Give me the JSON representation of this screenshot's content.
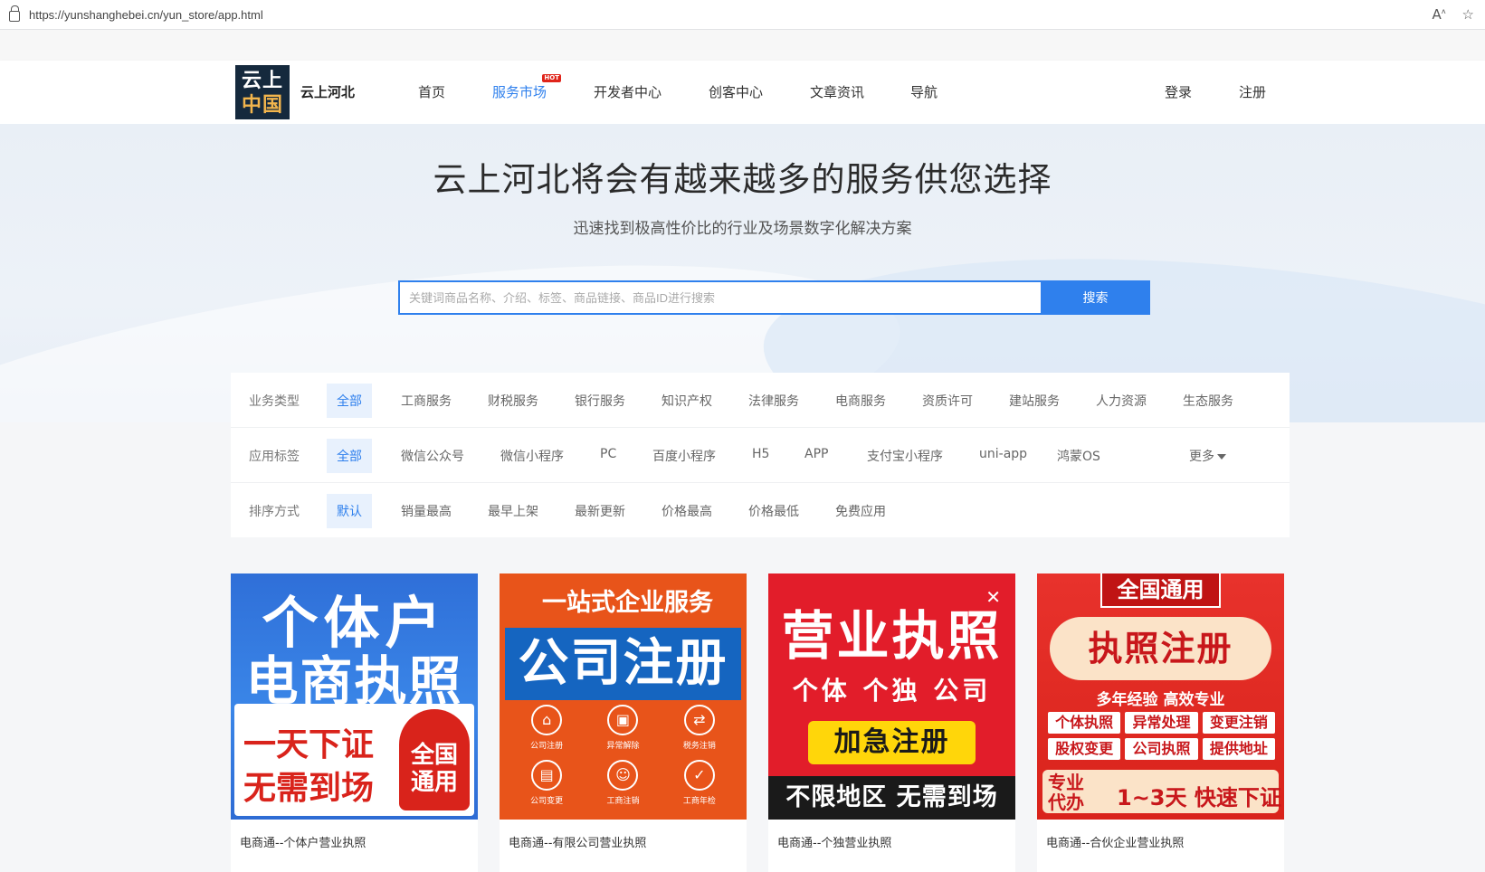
{
  "browser": {
    "url": "https://yunshanghebei.cn/yun_store/app.html"
  },
  "header": {
    "logo_line1": "云上",
    "logo_line2": "中国",
    "brand": "云上河北",
    "nav": [
      {
        "label": "首页"
      },
      {
        "label": "服务市场",
        "badge": "HOT"
      },
      {
        "label": "开发者中心"
      },
      {
        "label": "创客中心"
      },
      {
        "label": "文章资讯"
      },
      {
        "label": "导航"
      }
    ],
    "login": "登录",
    "register": "注册"
  },
  "hero": {
    "title": "云上河北将会有越来越多的服务供您选择",
    "subtitle": "迅速找到极高性价比的行业及场景数字化解决方案",
    "search_placeholder": "关键词商品名称、介绍、标签、商品链接、商品ID进行搜索",
    "search_button": "搜索"
  },
  "filters": {
    "business": {
      "label": "业务类型",
      "options": [
        "全部",
        "工商服务",
        "财税服务",
        "银行服务",
        "知识产权",
        "法律服务",
        "电商服务",
        "资质许可",
        "建站服务",
        "人力资源",
        "生态服务"
      ]
    },
    "tags": {
      "label": "应用标签",
      "options": [
        "全部",
        "微信公众号",
        "微信小程序",
        "PC",
        "百度小程序",
        "H5",
        "APP",
        "支付宝小程序",
        "uni-app",
        "鸿蒙OS"
      ],
      "more": "更多"
    },
    "sort": {
      "label": "排序方式",
      "options": [
        "默认",
        "销量最高",
        "最早上架",
        "最新更新",
        "价格最高",
        "价格最低",
        "免费应用"
      ]
    }
  },
  "cards": [
    {
      "title": "电商通--个体户营业执照",
      "img": {
        "line1": "个体户",
        "line2": "电商执照",
        "red1": "一天下证",
        "red2": "无需到场",
        "badge1": "全国",
        "badge2": "通用"
      }
    },
    {
      "title": "电商通--有限公司营业执照",
      "img": {
        "top": "一站式企业服务",
        "band": "公司注册",
        "icons": [
          "公司注册",
          "异常解除",
          "税务注销",
          "公司变更",
          "工商注销",
          "工商年检"
        ]
      }
    },
    {
      "title": "电商通--个独营业执照",
      "img": {
        "line1": "营业执照",
        "line2": "个体 个独 公司",
        "pill": "加急注册",
        "foot": "不限地区 无需到场"
      }
    },
    {
      "title": "电商通--合伙企业营业执照",
      "img": {
        "hdr": "全国通用",
        "ban": "执照注册",
        "sub": "多年经验 高效专业",
        "cells": [
          "个体执照",
          "异常处理",
          "变更注销",
          "股权变更",
          "公司执照",
          "提供地址"
        ],
        "bl1": "专业",
        "bl2": "代办",
        "br": "1~3天 快速下证"
      }
    }
  ],
  "colors": {
    "accent": "#2f80ed",
    "hot_badge": "#e0251b",
    "logo_bg": "#15293d"
  }
}
